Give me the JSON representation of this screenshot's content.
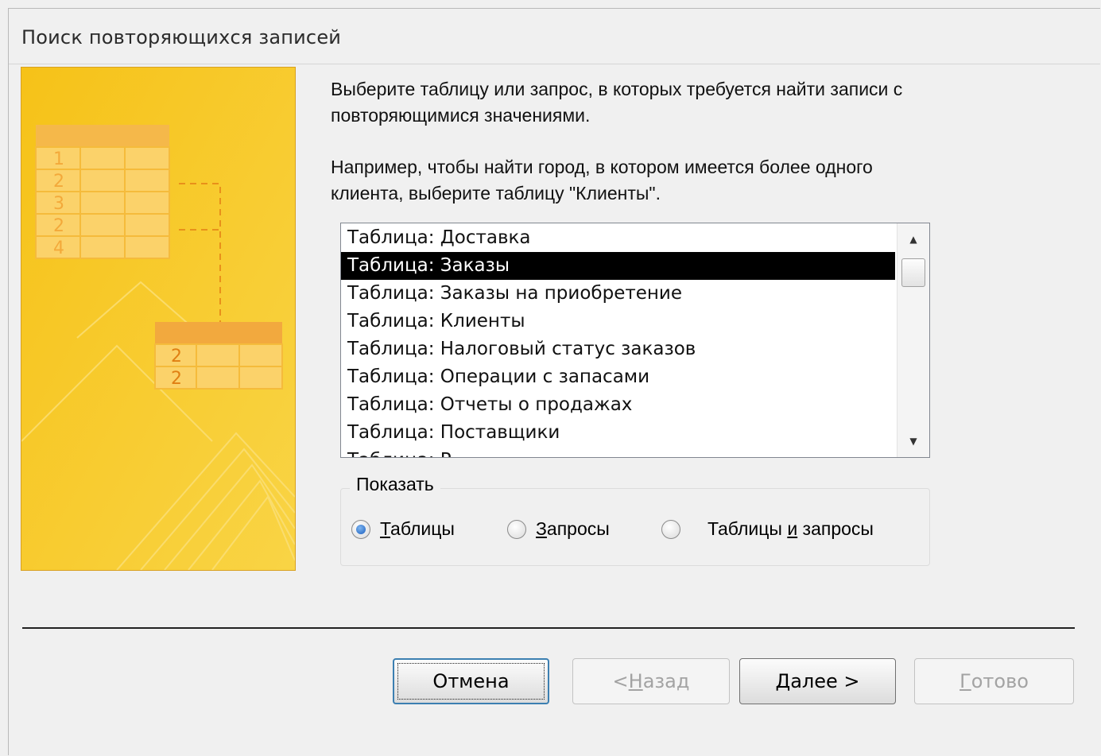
{
  "dialog": {
    "title": "Поиск повторяющихся записей"
  },
  "art": {
    "top_table_numbers": [
      "1",
      "2",
      "3",
      "2",
      "4"
    ],
    "bottom_table_numbers": [
      "2",
      "2"
    ],
    "colors": {
      "background": "#f7c21c",
      "accent": "#e8901a",
      "border": "#d8a020"
    }
  },
  "instructions": {
    "line1": "Выберите таблицу или запрос, в которых требуется найти записи с",
    "line2": "повторяющимися значениями.",
    "line3": "Например, чтобы найти город, в котором имеется более одного",
    "line4": "клиента, выберите таблицу \"Клиенты\"."
  },
  "list": {
    "items": [
      "Таблица: Доставка",
      "Таблица: Заказы",
      "Таблица: Заказы на приобретение",
      "Таблица: Клиенты",
      "Таблица: Налоговый статус заказов",
      "Таблица: Операции с запасами",
      "Таблица: Отчеты о продажах",
      "Таблица: Поставщики",
      "Таблица: Р..."
    ],
    "selected_index": 1
  },
  "show_group": {
    "label": "Показать",
    "options": [
      {
        "before": "",
        "mnemonic": "Т",
        "after": "аблицы",
        "checked": true
      },
      {
        "before": "",
        "mnemonic": "З",
        "after": "апросы",
        "checked": false
      },
      {
        "before": "Таблицы ",
        "mnemonic": "и",
        "after": " запросы",
        "checked": false
      }
    ]
  },
  "buttons": {
    "cancel": {
      "label": "Отмена"
    },
    "back": {
      "before": "< ",
      "mnemonic": "Н",
      "after": "азад"
    },
    "next": {
      "before": "",
      "mnemonic": "Д",
      "after": "алее >"
    },
    "finish": {
      "before": "",
      "mnemonic": "Г",
      "after": "отово"
    }
  }
}
